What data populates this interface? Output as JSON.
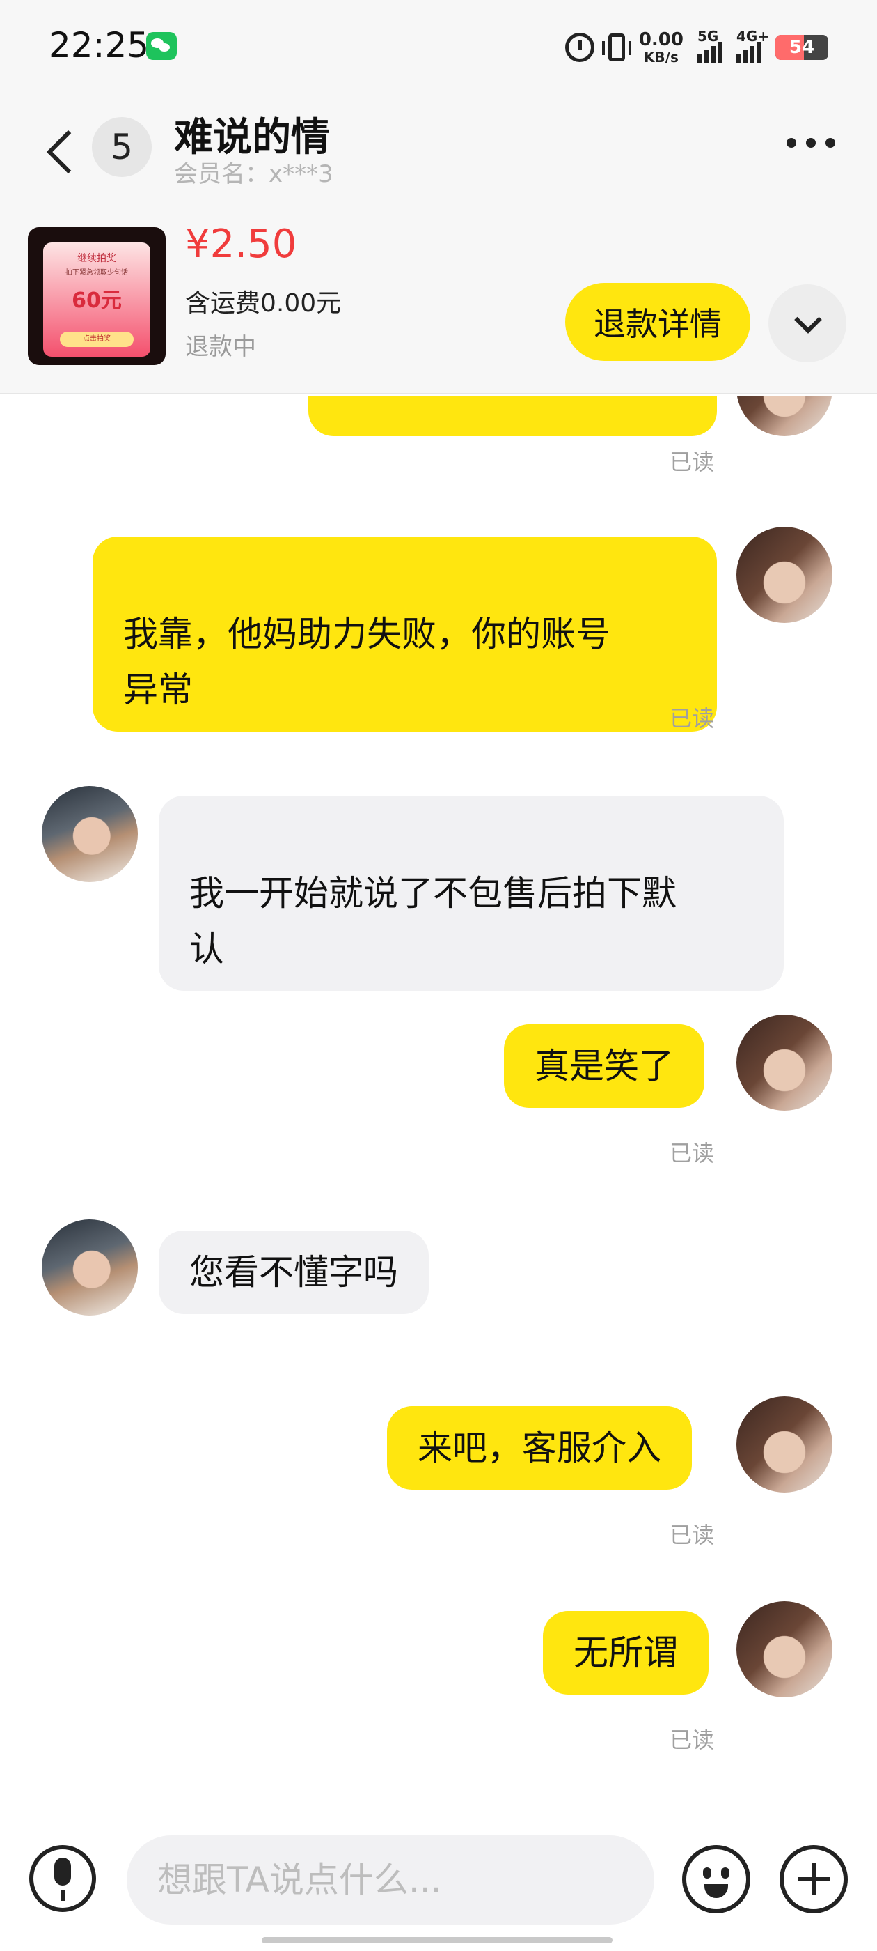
{
  "status_bar": {
    "time": "22:25",
    "net_speed_value": "0.00",
    "net_speed_unit": "KB/s",
    "signal_1_label": "5G",
    "signal_2_label": "4G+",
    "battery": "54",
    "battery_level": 0.54,
    "icons": [
      "wechat-icon",
      "alarm-icon",
      "vibrate-icon",
      "signal-icon",
      "battery-icon"
    ]
  },
  "header": {
    "unread_count": "5",
    "nickname": "难说的情",
    "member_label": "会员名：x***3"
  },
  "product": {
    "thumb_text_1": "继续拍奖",
    "thumb_text_2": "拍下紧急领取少句话",
    "thumb_text_3": "60元",
    "thumb_text_4": "点击拍奖",
    "price": "¥2.50",
    "shipping": "含运费0.00元",
    "status": "退款中",
    "refund_button": "退款详情"
  },
  "messages": [
    {
      "side": "out",
      "text": "",
      "read": "已读"
    },
    {
      "side": "out",
      "text": "我靠，他妈助力失败，你的账号\n异常",
      "read": "已读"
    },
    {
      "side": "in",
      "text": "我一开始就说了不包售后拍下默\n认"
    },
    {
      "side": "out",
      "text": "真是笑了",
      "read": "已读"
    },
    {
      "side": "in",
      "text": "您看不懂字吗"
    },
    {
      "side": "out",
      "text": "来吧，客服介入",
      "read": "已读"
    },
    {
      "side": "out",
      "text": "无所谓",
      "read": "已读"
    }
  ],
  "input": {
    "placeholder": "想跟TA说点什么..."
  },
  "colors": {
    "accent_yellow": "#ffe60f",
    "price_red": "#f03c3c",
    "incoming_bubble": "#f1f1f3",
    "read_gray": "#a0a0a0"
  }
}
